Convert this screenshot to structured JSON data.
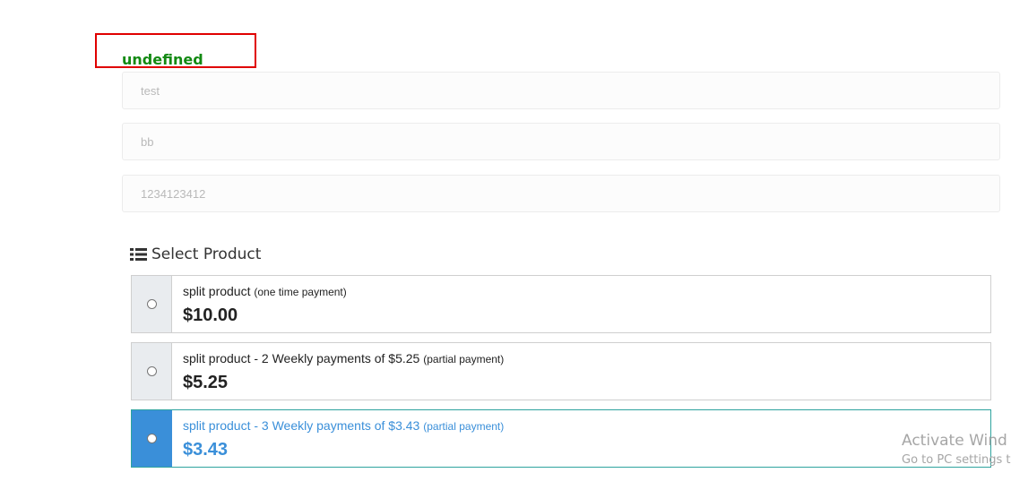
{
  "status": {
    "text": "undefined"
  },
  "form": {
    "fields": [
      {
        "value": "test"
      },
      {
        "value": "bb"
      },
      {
        "value": "1234123412"
      }
    ]
  },
  "products_section": {
    "title": "Select Product",
    "icon": "list-icon",
    "items": [
      {
        "name": "split product",
        "note": "(one time payment)",
        "price": "$10.00",
        "selected": false
      },
      {
        "name": "split product - 2 Weekly payments of $5.25",
        "note": "(partial payment)",
        "price": "$5.25",
        "selected": false
      },
      {
        "name": "split product - 3 Weekly payments of $3.43",
        "note": "(partial payment)",
        "price": "$3.43",
        "selected": true
      }
    ]
  },
  "watermark": {
    "title": "Activate Wind",
    "subtitle": "Go to PC settings t"
  },
  "colors": {
    "status_text": "#138a13",
    "status_border": "#e00000",
    "selected_accent": "#3a8fd9",
    "selected_border": "#2ea39e"
  }
}
